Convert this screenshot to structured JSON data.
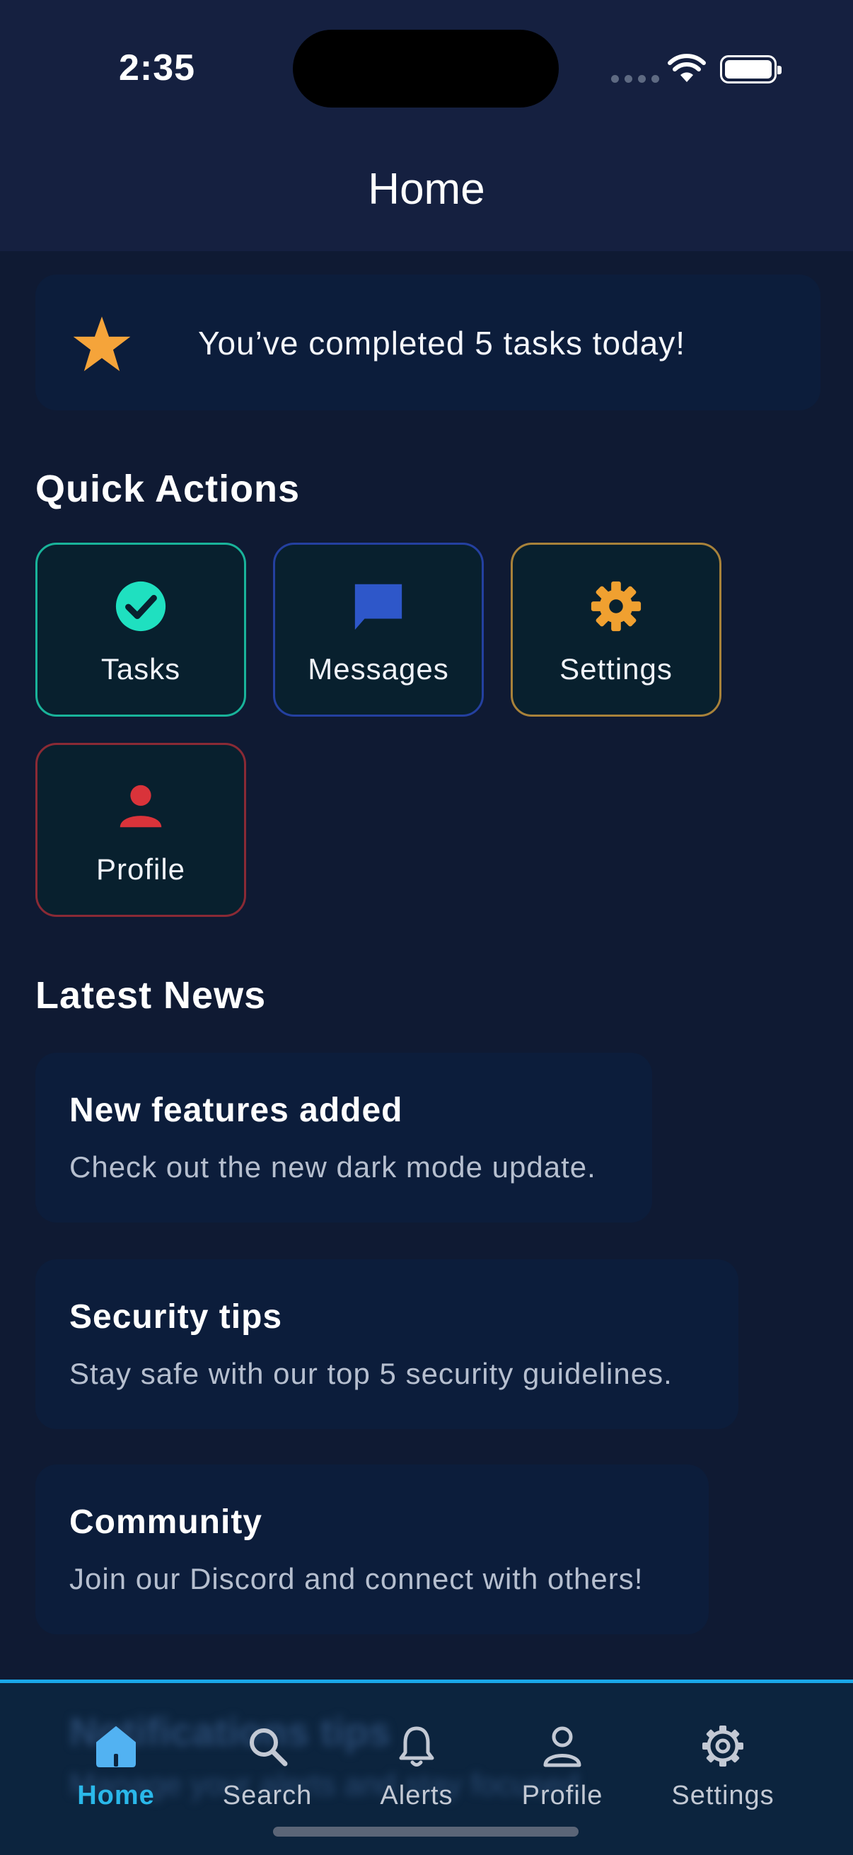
{
  "status_bar": {
    "time": "2:35"
  },
  "header": {
    "title": "Home"
  },
  "banner": {
    "icon": "star-icon",
    "text": "You’ve completed 5 tasks today!"
  },
  "quick_actions": {
    "title": "Quick Actions",
    "items": [
      {
        "label": "Tasks",
        "icon": "check-circle-icon",
        "color": "#1fd4b4"
      },
      {
        "label": "Messages",
        "icon": "chat-bubble-icon",
        "color": "#2e57c9"
      },
      {
        "label": "Settings",
        "icon": "gear-icon",
        "color": "#f0a030"
      },
      {
        "label": "Profile",
        "icon": "person-icon",
        "color": "#d9333a"
      }
    ]
  },
  "news": {
    "title": "Latest News",
    "items": [
      {
        "title": "New features added",
        "body": "Check out the new dark mode update."
      },
      {
        "title": "Security tips",
        "body": "Stay safe with our top 5 security guidelines."
      },
      {
        "title": "Community",
        "body": "Join our Discord and connect with others!"
      },
      {
        "title": "Notifications tips",
        "body": "Manage your alerts and stay focused."
      }
    ]
  },
  "tab_bar": {
    "items": [
      {
        "label": "Home",
        "icon": "home-icon",
        "active": true
      },
      {
        "label": "Search",
        "icon": "search-icon",
        "active": false
      },
      {
        "label": "Alerts",
        "icon": "bell-icon",
        "active": false
      },
      {
        "label": "Profile",
        "icon": "person-outline-icon",
        "active": false
      },
      {
        "label": "Settings",
        "icon": "gear-outline-icon",
        "active": false
      }
    ]
  },
  "colors": {
    "accent": "#2ab8ea",
    "background": "#0f1a33",
    "header": "#152040"
  }
}
